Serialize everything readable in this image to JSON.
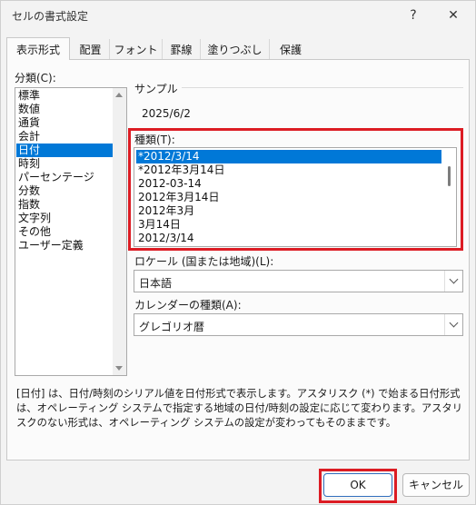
{
  "window": {
    "title": "セルの書式設定",
    "help": "?",
    "close": "✕"
  },
  "tabs": [
    "表示形式",
    "配置",
    "フォント",
    "罫線",
    "塗りつぶし",
    "保護"
  ],
  "category": {
    "label": "分類(C):",
    "items": [
      "標準",
      "数値",
      "通貨",
      "会計",
      "日付",
      "時刻",
      "パーセンテージ",
      "分数",
      "指数",
      "文字列",
      "その他",
      "ユーザー定義"
    ],
    "selected": "日付"
  },
  "sample": {
    "label": "サンプル",
    "value": "2025/6/2"
  },
  "type": {
    "label": "種類(T):",
    "items": [
      "*2012/3/14",
      "*2012年3月14日",
      "2012-03-14",
      "2012年3月14日",
      "2012年3月",
      "3月14日",
      "2012/3/14"
    ],
    "selected": "*2012/3/14"
  },
  "locale": {
    "label": "ロケール (国または地域)(L):",
    "value": "日本語"
  },
  "calendar": {
    "label": "カレンダーの種類(A):",
    "value": "グレゴリオ暦"
  },
  "description": "[日付] は、日付/時刻のシリアル値を日付形式で表示します。アスタリスク (*) で始まる日付形式は、オペレーティング システムで指定する地域の日付/時刻の設定に応じて変わります。アスタリスクのない形式は、オペレーティング システムの設定が変わってもそのままです。",
  "buttons": {
    "ok": "OK",
    "cancel": "キャンセル"
  },
  "colors": {
    "highlight_red": "#dc1c24",
    "selection_blue": "#0078d7"
  }
}
